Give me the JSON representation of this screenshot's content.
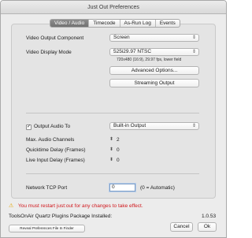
{
  "window": {
    "title": "Just Out Preferences"
  },
  "tabs": [
    {
      "label": "Video / Audio",
      "active": true
    },
    {
      "label": "Timecode",
      "active": false
    },
    {
      "label": "As-Run Log",
      "active": false
    },
    {
      "label": "Events",
      "active": false
    }
  ],
  "video": {
    "output_component_label": "Video Output Component",
    "output_component_value": "Screen",
    "display_mode_label": "Video Display Mode",
    "display_mode_value": "525i29.97 NTSC",
    "display_mode_info": "720x480 (16:9), 29.97 fps, lower field",
    "advanced_button": "Advanced Options...",
    "streaming_button": "Streaming Output"
  },
  "audio": {
    "output_audio_label": "Output Audio To",
    "output_audio_checked": true,
    "output_audio_value": "Built-in Output",
    "max_channels_label": "Max. Audio Channels",
    "max_channels_value": "2",
    "quicktime_delay_label": "Quicktime Delay (Frames)",
    "quicktime_delay_value": "0",
    "live_delay_label": "Live Input Delay (Frames)",
    "live_delay_value": "0"
  },
  "network": {
    "tcp_port_label": "Network TCP Port",
    "tcp_port_value": "0",
    "tcp_port_hint": "(0 = Automatic)"
  },
  "footer": {
    "warning": "You must restart just:out for any changes to take effect.",
    "package_label": "ToolsOnAir Quartz Plugins Package Installed:",
    "package_version": "1.0.53",
    "reveal_button": "Reveal Preferences File In Finder",
    "cancel_button": "Cancel",
    "ok_button": "Ok"
  },
  "icons": {
    "popup_chevron": "up-down-chevron-icon",
    "stepper": "stepper-arrows-icon",
    "warning": "warning-triangle-icon"
  },
  "colors": {
    "warning_text": "#d0161b",
    "warning_icon": "#e4a400",
    "active_tab": "#7a7a7a"
  }
}
